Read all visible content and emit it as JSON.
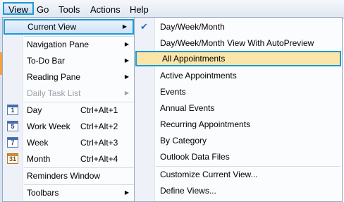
{
  "menubar": {
    "view": "View",
    "go": "Go",
    "tools": "Tools",
    "actions": "Actions",
    "help": "Help"
  },
  "left_menu": {
    "current_view": "Current View",
    "navigation_pane": "Navigation Pane",
    "todo_bar": "To-Do Bar",
    "reading_pane": "Reading Pane",
    "daily_task_list": "Daily Task List",
    "day": {
      "label": "Day",
      "shortcut": "Ctrl+Alt+1",
      "icon": "1"
    },
    "work_week": {
      "label": "Work Week",
      "shortcut": "Ctrl+Alt+2",
      "icon": "5"
    },
    "week": {
      "label": "Week",
      "shortcut": "Ctrl+Alt+3",
      "icon": "7"
    },
    "month": {
      "label": "Month",
      "shortcut": "Ctrl+Alt+4",
      "icon": "31"
    },
    "reminders_window": "Reminders Window",
    "toolbars": "Toolbars"
  },
  "submenu": {
    "checkmark": "✔",
    "day_week_month": "Day/Week/Month",
    "dwm_autopreview": "Day/Week/Month View With AutoPreview",
    "all_appointments": "All Appointments",
    "active_appointments": "Active Appointments",
    "events": "Events",
    "annual_events": "Annual Events",
    "recurring_appointments": "Recurring Appointments",
    "by_category": "By Category",
    "outlook_data_files": "Outlook Data Files",
    "customize_current_view": "Customize Current View...",
    "define_views": "Define Views..."
  }
}
